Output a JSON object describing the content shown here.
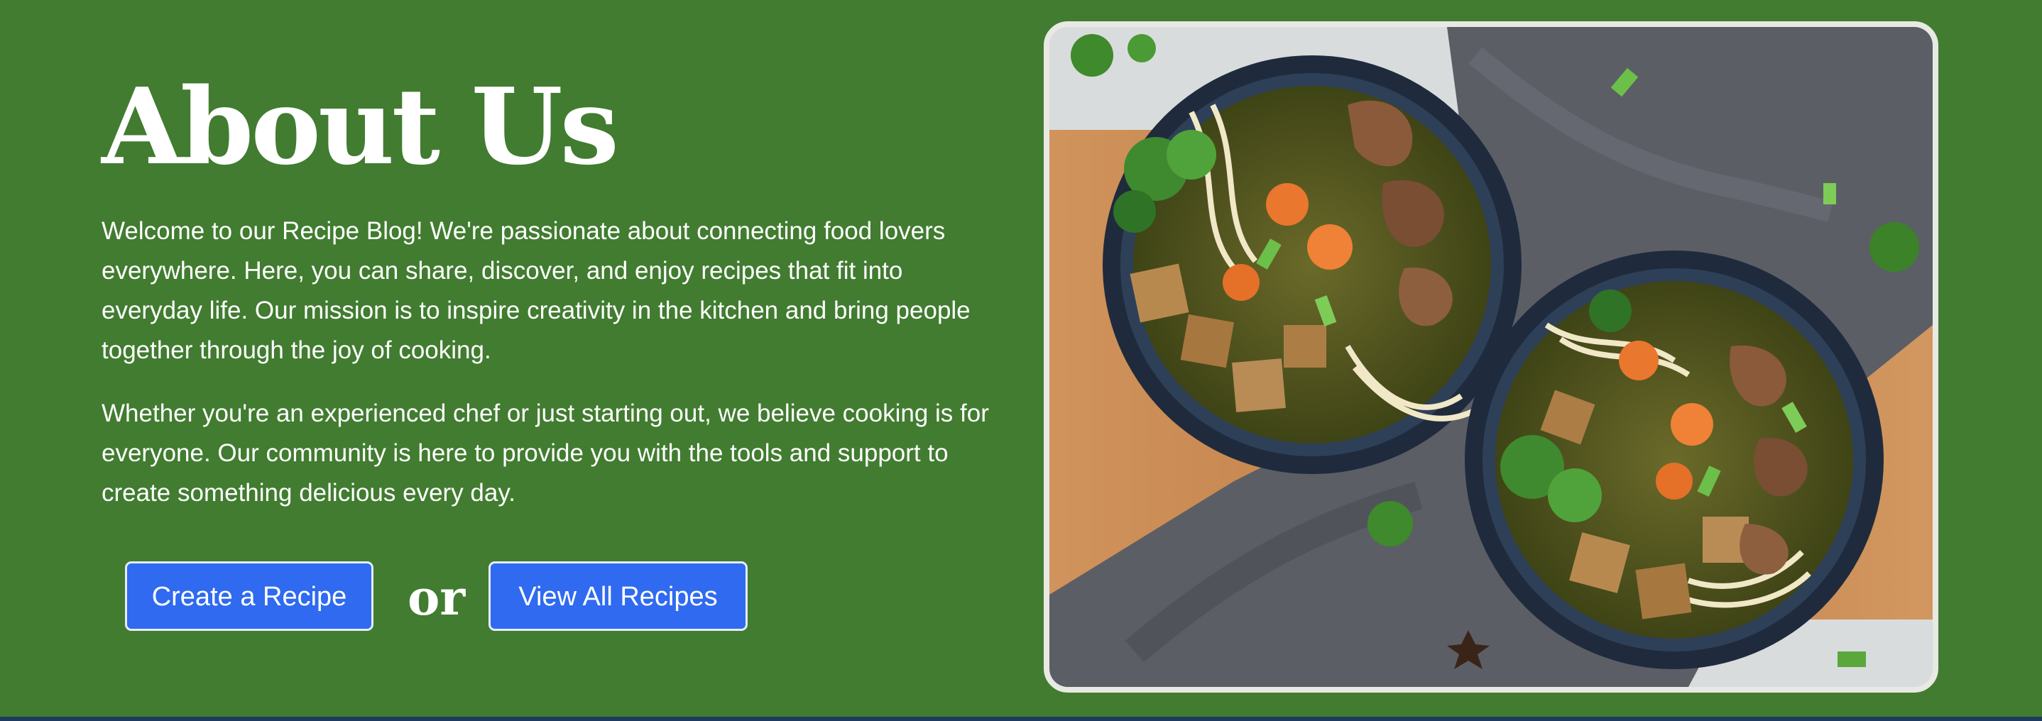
{
  "about": {
    "title": "About Us",
    "paragraph_1": "Welcome to our Recipe Blog! We're passionate about connecting food lovers everywhere. Here, you can share, discover, and enjoy recipes that fit into everyday life. Our mission is to inspire creativity in the kitchen and bring people together through the joy of cooking.",
    "paragraph_2": "Whether you're an experienced chef or just starting out, we believe cooking is for everyone. Our community is here to provide you with the tools and support to create something delicious every day.",
    "create_button_label": "Create a Recipe",
    "or_text": "or",
    "view_all_button_label": "View All Recipes"
  },
  "colors": {
    "section_background": "#417C30",
    "button_background": "#2F6AF0",
    "footer_strip": "#1E3A5F"
  }
}
